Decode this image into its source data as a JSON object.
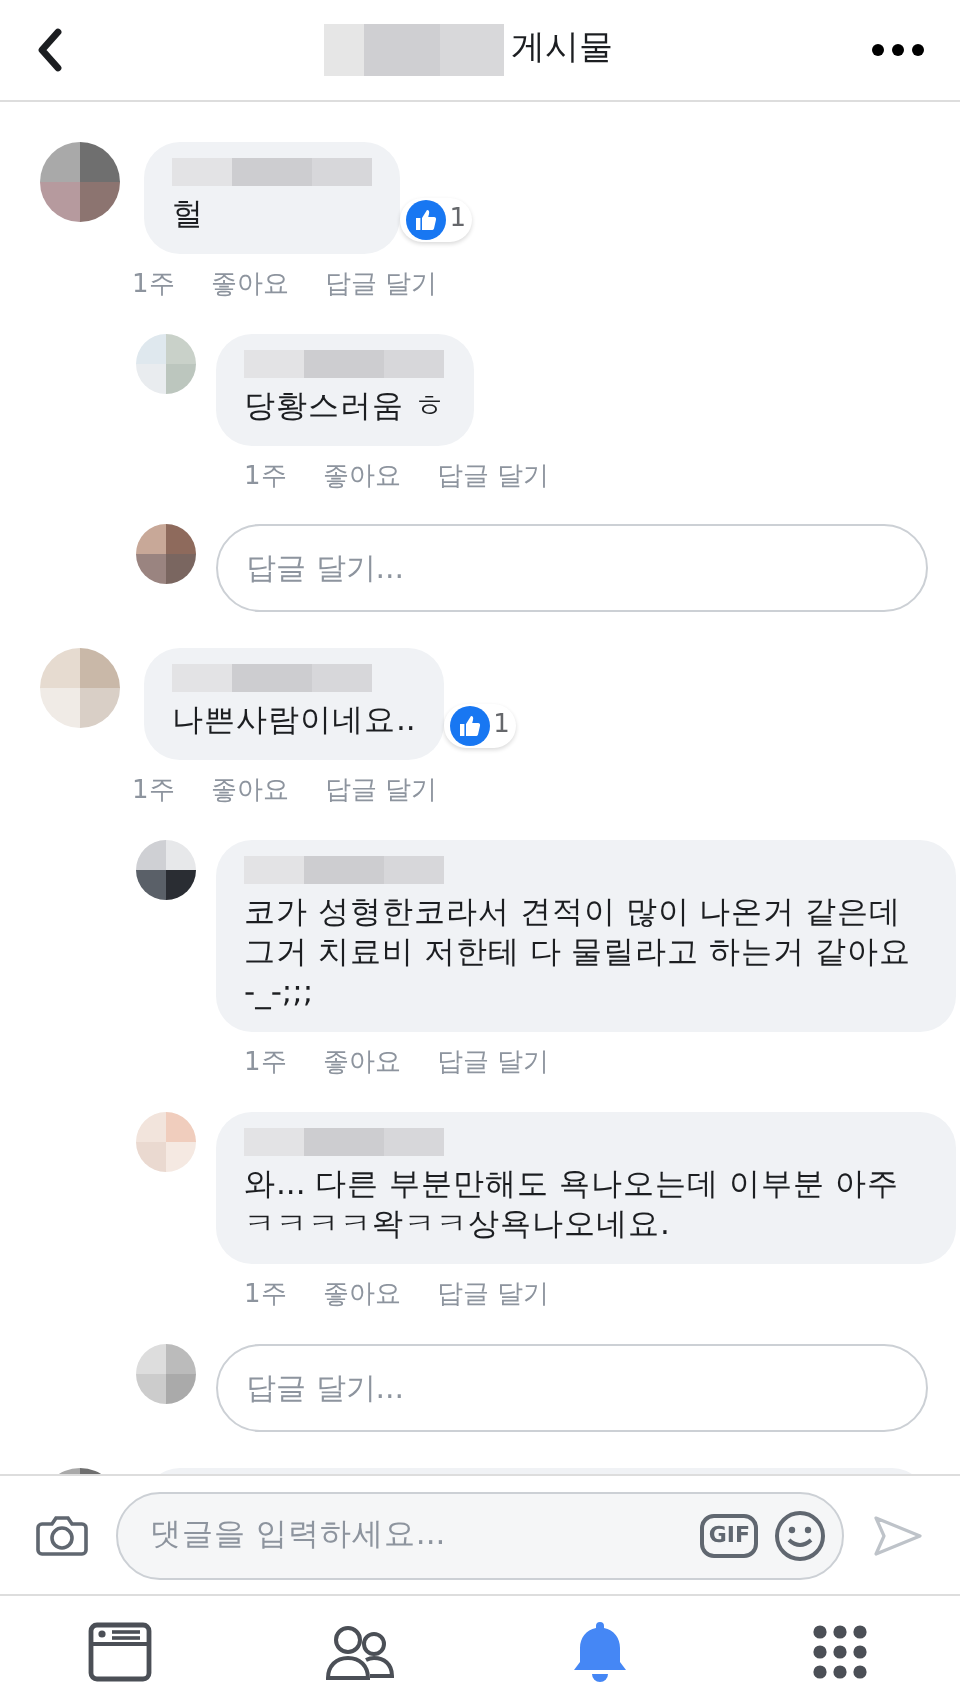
{
  "header": {
    "title": "게시물"
  },
  "comments": [
    {
      "kind": "comment",
      "text": "헐",
      "likes": "1",
      "time": "1주",
      "like": "좋아요",
      "reply": "답글 달기",
      "replies": [
        {
          "text": "당황스러움 ㅎ",
          "time": "1주",
          "like": "좋아요",
          "reply": "답글 달기"
        }
      ],
      "reply_placeholder": "답글 달기..."
    },
    {
      "kind": "comment",
      "text": "나쁜사람이네요..",
      "likes": "1",
      "time": "1주",
      "like": "좋아요",
      "reply": "답글 달기",
      "replies": [
        {
          "text": "코가 성형한코라서 견적이 많이 나온거 같은데 그거 치료비 저한테 다 물릴라고 하는거 같아요 -_-;;;",
          "time": "1주",
          "like": "좋아요",
          "reply": "답글 달기"
        },
        {
          "text": "와... 다른 부분만해도 욕나오는데 이부분 아주 ㅋㅋㅋㅋ왁ㅋㅋ상욕나오네요.",
          "time": "1주",
          "like": "좋아요",
          "reply": "답글 달기"
        }
      ],
      "reply_placeholder": "답글 달기..."
    },
    {
      "kind": "cut_off"
    }
  ],
  "composer": {
    "placeholder": "댓글을 입력하세요...",
    "gif": "GIF"
  },
  "tabs": [
    {
      "selected": false
    },
    {
      "selected": false
    },
    {
      "selected": true
    },
    {
      "selected": false
    }
  ]
}
